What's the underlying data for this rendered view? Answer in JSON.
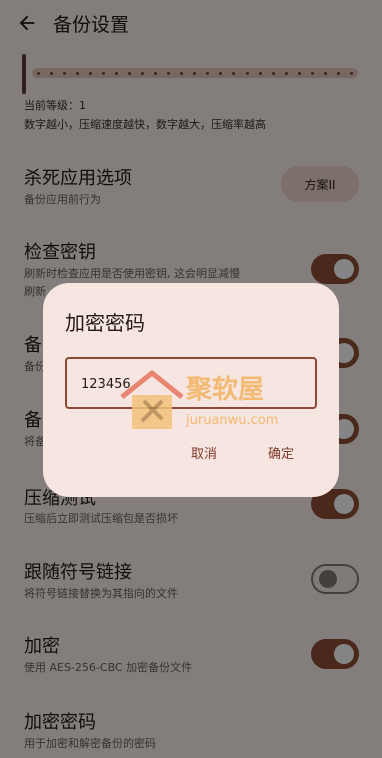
{
  "appbar": {
    "title": "备份设置",
    "back_icon": "arrow-left-icon"
  },
  "compression": {
    "level_label": "当前等级：1",
    "description": "数字越小，压缩速度越快，数字越大，压缩率越高"
  },
  "settings": [
    {
      "title": "杀死应用选项",
      "subtitle": "备份应用前行为",
      "chip": "方案II"
    },
    {
      "title": "检查密钥",
      "subtitle": "刷新时检查应用是否使用密钥, 这会明显减慢",
      "subtitle2": "刷新",
      "toggle": true
    },
    {
      "title": "备",
      "subtitle": "备份",
      "toggle": true
    },
    {
      "title": "备",
      "subtitle": "将备",
      "toggle": true
    },
    {
      "title": "压缩测试",
      "subtitle": "压缩后立即测试压缩包是否损坏",
      "toggle": true
    },
    {
      "title": "跟随符号链接",
      "subtitle": "将符号链接替换为其指向的文件",
      "toggle": false
    },
    {
      "title": "加密",
      "subtitle": "使用 AES-256-CBC 加密备份文件",
      "toggle": true
    },
    {
      "title": "加密密码",
      "subtitle": "用于加密和解密备份的密码"
    }
  ],
  "dialog": {
    "title": "加密密码",
    "password_value": "123456",
    "cancel_label": "取消",
    "confirm_label": "确定"
  },
  "watermark": {
    "text": "聚软屋",
    "url": "juruanwu.com"
  },
  "colors": {
    "primary": "#8e4d36",
    "background": "#fbf1ee",
    "dialog": "#f6e5e0"
  }
}
